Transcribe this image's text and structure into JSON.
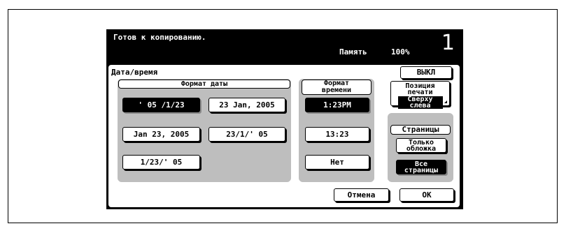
{
  "status": {
    "title": "Готов к копированию.",
    "memory_label": "Память",
    "memory_value": "100%",
    "count": "1"
  },
  "panel": {
    "title": "Дата/время",
    "off_button": "ВЫКЛ",
    "date_format": {
      "header": "Формат даты",
      "options": [
        "' 05 /1/23",
        "23 Jan, 2005",
        "Jan 23, 2005",
        "23/1/' 05",
        "1/23/' 05"
      ],
      "selected": "' 05 /1/23"
    },
    "time_format": {
      "header_line1": "Формат",
      "header_line2": "времени",
      "options": [
        "1:23PM",
        "13:23",
        "Нет"
      ],
      "selected": "1:23PM"
    },
    "print_position": {
      "line1": "Позиция",
      "line2": "печати",
      "value_line1": "Сверху",
      "value_line2": "слева"
    },
    "pages": {
      "header": "Страницы",
      "cover_only_line1": "Только",
      "cover_only_line2": "обложка",
      "all_pages_line1": "Все",
      "all_pages_line2": "страницы",
      "selected": "all"
    },
    "cancel_button": "Отмена",
    "ok_button": "OK"
  }
}
